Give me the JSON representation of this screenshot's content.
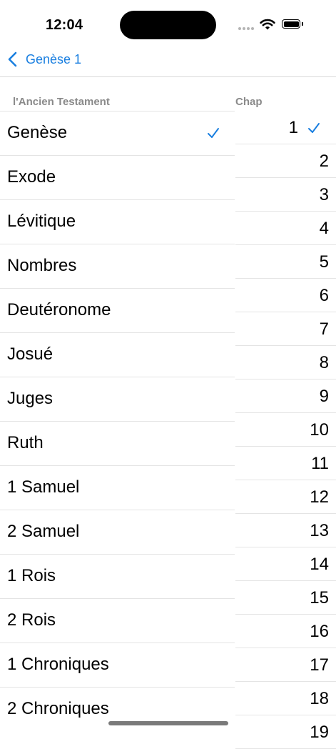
{
  "status": {
    "time": "12:04"
  },
  "nav": {
    "back_label": "Genèse 1"
  },
  "headers": {
    "books": "l'Ancien Testament",
    "chapters": "Chap"
  },
  "books": [
    {
      "label": "Genèse",
      "selected": true
    },
    {
      "label": "Exode"
    },
    {
      "label": "Lévitique"
    },
    {
      "label": "Nombres"
    },
    {
      "label": "Deutéronome"
    },
    {
      "label": "Josué"
    },
    {
      "label": "Juges"
    },
    {
      "label": "Ruth"
    },
    {
      "label": "1 Samuel"
    },
    {
      "label": "2 Samuel"
    },
    {
      "label": "1 Rois"
    },
    {
      "label": "2 Rois"
    },
    {
      "label": "1 Chroniques"
    },
    {
      "label": "2 Chroniques"
    }
  ],
  "chapters": [
    "1",
    "2",
    "3",
    "4",
    "5",
    "6",
    "7",
    "8",
    "9",
    "10",
    "11",
    "12",
    "13",
    "14",
    "15",
    "16",
    "17",
    "18",
    "19"
  ],
  "selected_chapter": "1",
  "colors": {
    "accent": "#1a7fe0",
    "separator": "#e4e4e4",
    "header_text": "#8a8a8a"
  },
  "icons": {
    "back": "chevron-left-icon",
    "check": "checkmark-icon",
    "wifi": "wifi-icon",
    "battery": "battery-icon",
    "signal": "cellular-signal-icon"
  }
}
